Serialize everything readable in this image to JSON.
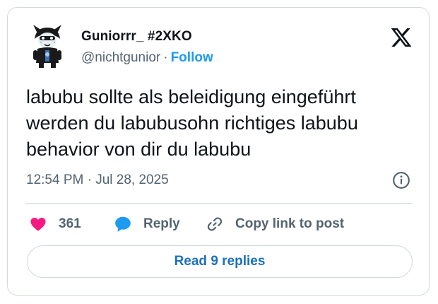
{
  "author": {
    "display_name": "Guniorrr_ #2XKO",
    "handle": "@nichtgunior",
    "separator": "·",
    "follow_label": "Follow"
  },
  "tweet": {
    "text": "labubu sollte als beleidigung eingeführt\nwerden du labubusohn richtiges labubu\nbehavior von dir du labubu",
    "timestamp": "12:54 PM · Jul 28, 2025"
  },
  "actions": {
    "like_count": "361",
    "reply_label": "Reply",
    "copy_link_label": "Copy link to post"
  },
  "read_replies_label": "Read 9 replies",
  "icons": {
    "logo": "x-logo-icon",
    "info": "info-icon",
    "like": "heart-icon",
    "reply": "speech-bubble-icon",
    "copy": "link-icon"
  },
  "colors": {
    "accent": "#1d9bf0",
    "heart": "#f91880",
    "text": "#0f1419",
    "muted": "#536471",
    "border": "#cfd9de"
  }
}
